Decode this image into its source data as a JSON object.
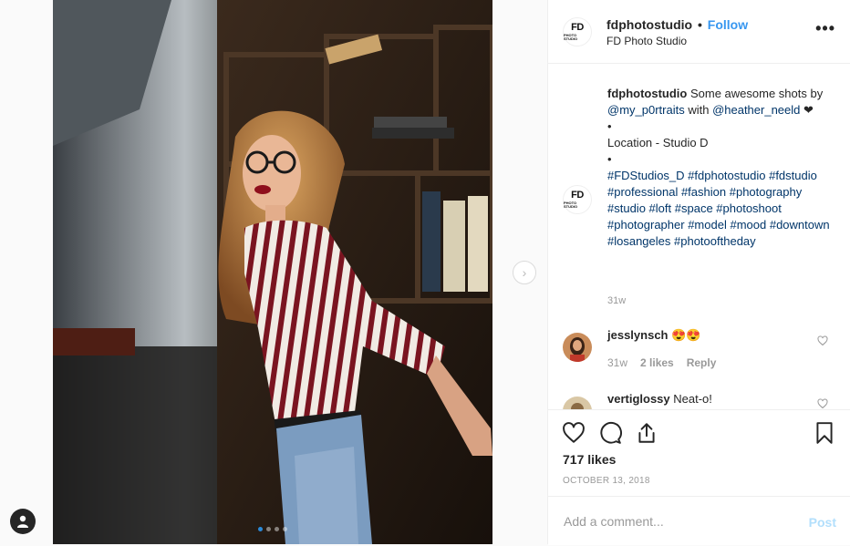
{
  "header": {
    "username": "fdphotostudio",
    "separator": "•",
    "follow_label": "Follow",
    "subtitle": "FD Photo Studio",
    "logo_big": "FD",
    "logo_small": "PHOTO STUDIO",
    "more_label": "•••"
  },
  "caption": {
    "username": "fdphotostudio",
    "text_1": " Some awesome shots by ",
    "mention_1": "@my_p0rtraits",
    "text_2": " with ",
    "mention_2": "@heather_neeld",
    "text_3": " ❤",
    "bullet": "•",
    "location": "Location - Studio D",
    "hashtags": [
      "#FDStudios_D",
      "#fdphotostudio",
      "#fdstudio",
      "#professional",
      "#fashion",
      "#photography",
      "#studio",
      "#loft",
      "#space",
      "#photoshoot",
      "#photographer",
      "#model",
      "#mood",
      "#downtown",
      "#losangeles",
      "#photooftheday"
    ],
    "time": "31w"
  },
  "comments": [
    {
      "username": "jesslynsch",
      "text": " 😍😍",
      "time": "31w",
      "likes": "2 likes",
      "reply": "Reply"
    },
    {
      "username": "vertiglossy",
      "text": " Neat-o!"
    }
  ],
  "actions": {
    "likes": "717 likes",
    "date": "OCTOBER 13, 2018",
    "comment_placeholder": "Add a comment...",
    "post_label": "Post",
    "next_arrow": "›"
  },
  "carousel": {
    "count": 4,
    "active_index": 0
  },
  "colors": {
    "link": "#003569",
    "follow": "#3897f0",
    "post_disabled": "#b2dffc",
    "active_dot": "#2b8ad8"
  }
}
